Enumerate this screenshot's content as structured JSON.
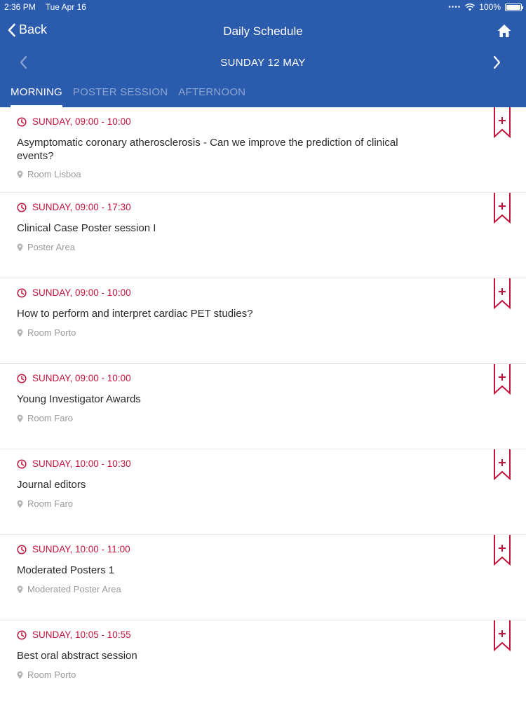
{
  "status_bar": {
    "time": "2:36 PM",
    "date": "Tue Apr 16",
    "signal_dots": "••••",
    "battery_text": "100%",
    "battery_level": 1.0
  },
  "nav": {
    "back_label": "Back",
    "title": "Daily Schedule",
    "home_icon": "home-icon"
  },
  "date_bar": {
    "label": "SUNDAY 12 MAY"
  },
  "tabs": [
    {
      "label": "MORNING",
      "active": true
    },
    {
      "label": "POSTER SESSION",
      "active": false
    },
    {
      "label": "AFTERNOON",
      "active": false
    }
  ],
  "sessions": [
    {
      "time": "SUNDAY, 09:00 - 10:00",
      "title": "Asymptomatic coronary atherosclerosis - Can we improve the prediction of clinical events?",
      "location": "Room Lisboa"
    },
    {
      "time": "SUNDAY, 09:00 - 17:30",
      "title": "Clinical Case Poster session I",
      "location": "Poster Area"
    },
    {
      "time": "SUNDAY, 09:00 - 10:00",
      "title": "How to perform and interpret cardiac PET studies?",
      "location": "Room Porto"
    },
    {
      "time": "SUNDAY, 09:00 - 10:00",
      "title": "Young Investigator Awards",
      "location": "Room Faro"
    },
    {
      "time": "SUNDAY, 10:00 - 10:30",
      "title": "Journal editors",
      "location": "Room Faro"
    },
    {
      "time": "SUNDAY, 10:00 - 11:00",
      "title": "Moderated Posters 1",
      "location": "Moderated Poster Area"
    },
    {
      "time": "SUNDAY, 10:05 - 10:55",
      "title": "Best oral abstract session",
      "location": "Room Porto"
    }
  ],
  "colors": {
    "header": "#2b5bad",
    "accent": "#c2133c",
    "location": "#9a9a9a"
  }
}
